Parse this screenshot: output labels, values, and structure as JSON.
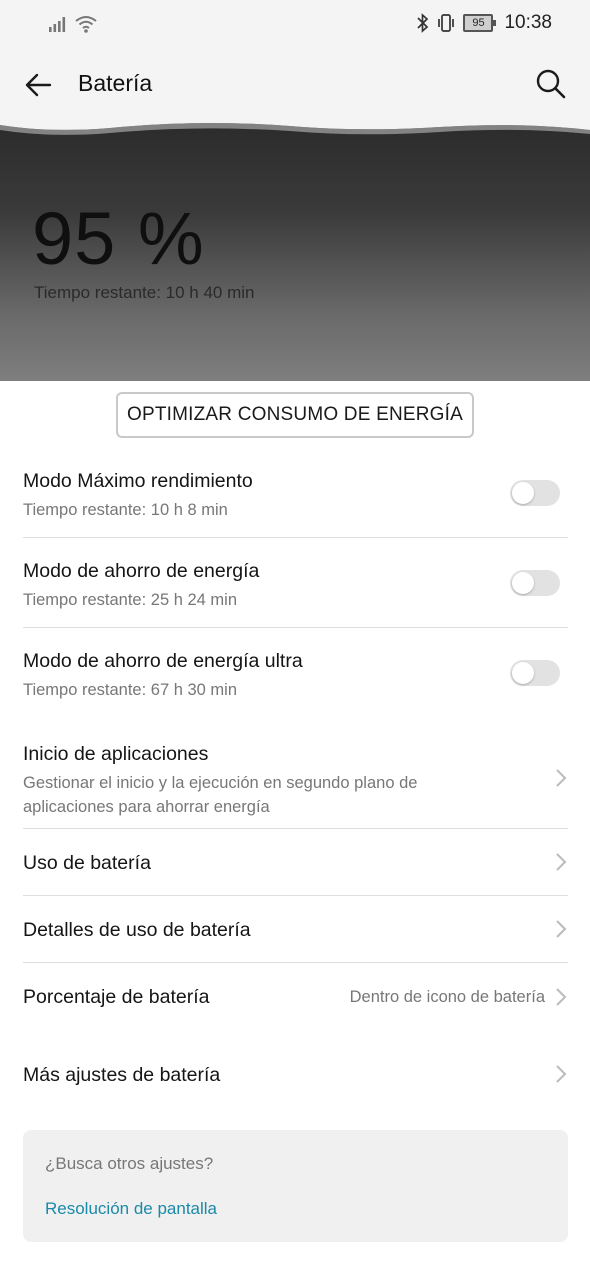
{
  "status_bar": {
    "time": "10:38",
    "battery_level": "95",
    "icons": [
      "signal-icon",
      "wifi-icon",
      "bluetooth-icon",
      "vibrate-icon",
      "battery-icon"
    ]
  },
  "header": {
    "title": "Batería",
    "back_icon": "back-arrow-icon",
    "search_icon": "search-icon"
  },
  "hero": {
    "percent": "95 %",
    "remaining": "Tiempo restante: 10 h 40 min"
  },
  "optimize_button": "OPTIMIZAR CONSUMO DE ENERGÍA",
  "modes": [
    {
      "title": "Modo Máximo rendimiento",
      "subtitle": "Tiempo restante: 10 h 8 min",
      "enabled": false
    },
    {
      "title": "Modo de ahorro de energía",
      "subtitle": "Tiempo restante: 25 h 24 min",
      "enabled": false
    },
    {
      "title": "Modo de ahorro de energía ultra",
      "subtitle": "Tiempo restante: 67 h 30 min",
      "enabled": false
    }
  ],
  "app_launch": {
    "title": "Inicio de aplicaciones",
    "subtitle": "Gestionar el inicio y la ejecución en segundo plano de aplicaciones para ahorrar energía"
  },
  "battery_usage": {
    "title": "Uso de batería"
  },
  "battery_usage_details": {
    "title": "Detalles de uso de batería"
  },
  "battery_percentage": {
    "title": "Porcentaje de batería",
    "value": "Dentro de icono de batería"
  },
  "more_settings": {
    "title": "Más ajustes de batería"
  },
  "suggestions": {
    "question": "¿Busca otros ajustes?",
    "link": "Resolución de pantalla"
  },
  "colors": {
    "accent_link": "#1a8aa8",
    "hero_top": "#2b2b2b",
    "hero_bottom": "#7e7e7e"
  }
}
